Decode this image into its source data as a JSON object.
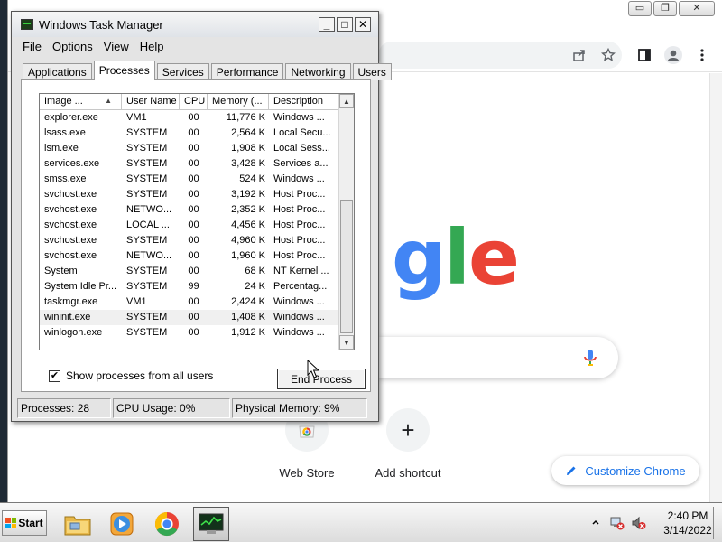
{
  "chrome": {
    "window_buttons": {
      "minimize": "▭",
      "maximize": "❐",
      "close": "✕"
    },
    "toolbar_icons": [
      "share-icon",
      "star-icon",
      "sidepanel-icon",
      "profile-icon",
      "kebab-menu-icon"
    ],
    "logo_text": "gle",
    "logo_letters": [
      {
        "ch": "g",
        "color": "#4285F4"
      },
      {
        "ch": "l",
        "color": "#34A853"
      },
      {
        "ch": "e",
        "color": "#EA4335"
      }
    ],
    "shortcuts": [
      {
        "label": "Web Store",
        "icon": "chrome-webstore-icon"
      },
      {
        "label": "Add shortcut",
        "icon": "plus-icon"
      }
    ],
    "customize_label": "Customize Chrome",
    "accent": "#1a73e8"
  },
  "task_manager": {
    "title": "Windows Task Manager",
    "window_buttons": {
      "minimize": "_",
      "maximize": "□",
      "close": "✕"
    },
    "menu": [
      "File",
      "Options",
      "View",
      "Help"
    ],
    "tabs": [
      "Applications",
      "Processes",
      "Services",
      "Performance",
      "Networking",
      "Users"
    ],
    "active_tab": "Processes",
    "columns": [
      "Image ...",
      "User Name",
      "CPU",
      "Memory (...",
      "Description"
    ],
    "rows": [
      {
        "image": "explorer.exe",
        "user": "VM1",
        "cpu": "00",
        "mem": "11,776 K",
        "desc": "Windows ..."
      },
      {
        "image": "lsass.exe",
        "user": "SYSTEM",
        "cpu": "00",
        "mem": "2,564 K",
        "desc": "Local Secu..."
      },
      {
        "image": "lsm.exe",
        "user": "SYSTEM",
        "cpu": "00",
        "mem": "1,908 K",
        "desc": "Local Sess..."
      },
      {
        "image": "services.exe",
        "user": "SYSTEM",
        "cpu": "00",
        "mem": "3,428 K",
        "desc": "Services a..."
      },
      {
        "image": "smss.exe",
        "user": "SYSTEM",
        "cpu": "00",
        "mem": "524 K",
        "desc": "Windows ..."
      },
      {
        "image": "svchost.exe",
        "user": "SYSTEM",
        "cpu": "00",
        "mem": "3,192 K",
        "desc": "Host Proc..."
      },
      {
        "image": "svchost.exe",
        "user": "NETWO...",
        "cpu": "00",
        "mem": "2,352 K",
        "desc": "Host Proc..."
      },
      {
        "image": "svchost.exe",
        "user": "LOCAL ...",
        "cpu": "00",
        "mem": "4,456 K",
        "desc": "Host Proc..."
      },
      {
        "image": "svchost.exe",
        "user": "SYSTEM",
        "cpu": "00",
        "mem": "4,960 K",
        "desc": "Host Proc..."
      },
      {
        "image": "svchost.exe",
        "user": "NETWO...",
        "cpu": "00",
        "mem": "1,960 K",
        "desc": "Host Proc..."
      },
      {
        "image": "System",
        "user": "SYSTEM",
        "cpu": "00",
        "mem": "68 K",
        "desc": "NT Kernel ..."
      },
      {
        "image": "System Idle Pr...",
        "user": "SYSTEM",
        "cpu": "99",
        "mem": "24 K",
        "desc": "Percentag..."
      },
      {
        "image": "taskmgr.exe",
        "user": "VM1",
        "cpu": "00",
        "mem": "2,424 K",
        "desc": "Windows ..."
      },
      {
        "image": "wininit.exe",
        "user": "SYSTEM",
        "cpu": "00",
        "mem": "1,408 K",
        "desc": "Windows ..."
      },
      {
        "image": "winlogon.exe",
        "user": "SYSTEM",
        "cpu": "00",
        "mem": "1,912 K",
        "desc": "Windows ..."
      }
    ],
    "hovered_row_index": 13,
    "show_all_label": "Show processes from all users",
    "show_all_checked": true,
    "end_process_label": "End Process",
    "status": {
      "processes": "Processes: 28",
      "cpu": "CPU Usage: 0%",
      "memory": "Physical Memory: 9%"
    }
  },
  "taskbar": {
    "start_label": "Start",
    "apps": [
      "explorer-icon",
      "media-player-icon",
      "chrome-icon",
      "task-manager-icon"
    ],
    "active_app": "task-manager-icon",
    "tray_icons": [
      "show-hidden-icons",
      "network-error-icon",
      "volume-muted-icon"
    ],
    "time": "2:40 PM",
    "date": "3/14/2022"
  }
}
